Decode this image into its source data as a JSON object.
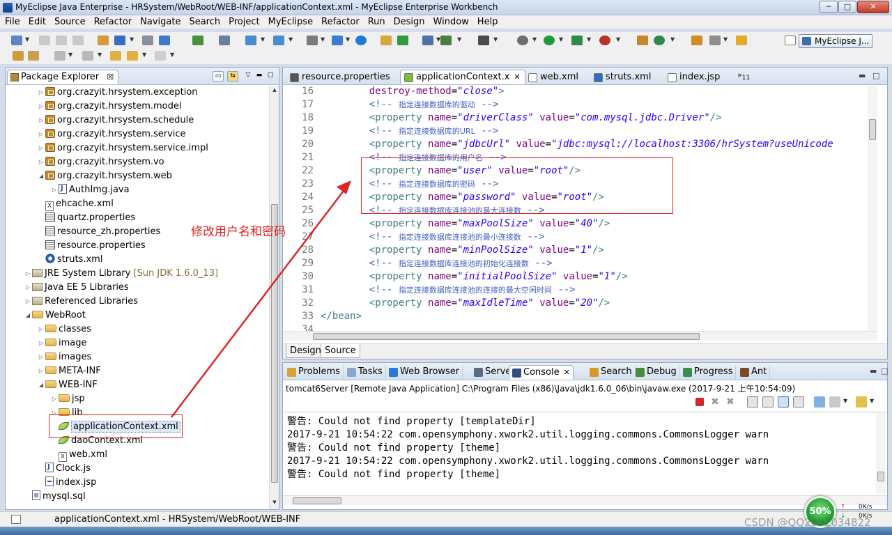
{
  "window": {
    "title": "MyEclipse Java Enterprise - HRSystem/WebRoot/WEB-INF/applicationContext.xml - MyEclipse Enterprise Workbench",
    "min": "─",
    "max": "□",
    "close": "✕"
  },
  "menu": [
    "File",
    "Edit",
    "Source",
    "Refactor",
    "Navigate",
    "Search",
    "Project",
    "MyEclipse",
    "Refactor",
    "Run",
    "Design",
    "Window",
    "Help"
  ],
  "perspective": "MyEclipse J...",
  "package_explorer": {
    "title": "Package Explorer",
    "close": "☒",
    "items": [
      {
        "label": "org.crazyit.hrsystem.exception",
        "icon": "package-icon",
        "depth": 2,
        "twisty": "▷"
      },
      {
        "label": "org.crazyit.hrsystem.model",
        "icon": "package-icon",
        "depth": 2,
        "twisty": "▷"
      },
      {
        "label": "org.crazyit.hrsystem.schedule",
        "icon": "package-icon",
        "depth": 2,
        "twisty": "▷"
      },
      {
        "label": "org.crazyit.hrsystem.service",
        "icon": "package-icon",
        "depth": 2,
        "twisty": "▷"
      },
      {
        "label": "org.crazyit.hrsystem.service.impl",
        "icon": "package-icon",
        "depth": 2,
        "twisty": "▷"
      },
      {
        "label": "org.crazyit.hrsystem.vo",
        "icon": "package-icon",
        "depth": 2,
        "twisty": "▷"
      },
      {
        "label": "org.crazyit.hrsystem.web",
        "icon": "package-icon",
        "depth": 2,
        "twisty": "◢"
      },
      {
        "label": "AuthImg.java",
        "icon": "java-file-icon",
        "depth": 3,
        "twisty": "▷"
      },
      {
        "label": "ehcache.xml",
        "icon": "xml-file-icon",
        "depth": 2,
        "twisty": ""
      },
      {
        "label": "quartz.properties",
        "icon": "properties-file-icon",
        "depth": 2,
        "twisty": ""
      },
      {
        "label": "resource_zh.properties",
        "icon": "properties-file-icon",
        "depth": 2,
        "twisty": ""
      },
      {
        "label": "resource.properties",
        "icon": "properties-file-icon",
        "depth": 2,
        "twisty": ""
      },
      {
        "label": "struts.xml",
        "icon": "struts-gear-icon",
        "depth": 2,
        "twisty": ""
      },
      {
        "label": "JRE System Library",
        "suffix": "[Sun JDK 1.6.0_13]",
        "icon": "library-icon",
        "depth": 1,
        "twisty": "▷"
      },
      {
        "label": "Java EE 5 Libraries",
        "icon": "library-icon",
        "depth": 1,
        "twisty": "▷"
      },
      {
        "label": "Referenced Libraries",
        "icon": "library-icon",
        "depth": 1,
        "twisty": "▷"
      },
      {
        "label": "WebRoot",
        "icon": "folder-icon",
        "depth": 1,
        "twisty": "◢"
      },
      {
        "label": "classes",
        "icon": "folder-icon",
        "depth": 2,
        "twisty": "▷"
      },
      {
        "label": "image",
        "icon": "folder-icon",
        "depth": 2,
        "twisty": "▷"
      },
      {
        "label": "images",
        "icon": "folder-icon",
        "depth": 2,
        "twisty": "▷"
      },
      {
        "label": "META-INF",
        "icon": "folder-icon",
        "depth": 2,
        "twisty": "▷"
      },
      {
        "label": "WEB-INF",
        "icon": "folder-icon",
        "depth": 2,
        "twisty": "◢"
      },
      {
        "label": "jsp",
        "icon": "folder-icon",
        "depth": 3,
        "twisty": "▷"
      },
      {
        "label": "lib",
        "icon": "folder-icon",
        "depth": 3,
        "twisty": "▷"
      },
      {
        "label": "applicationContext.xml",
        "icon": "spring-leaf-icon",
        "depth": 3,
        "twisty": "",
        "selected": true
      },
      {
        "label": "daoContext.xml",
        "icon": "spring-leaf-icon",
        "depth": 3,
        "twisty": ""
      },
      {
        "label": "web.xml",
        "icon": "xml-file-icon",
        "depth": 3,
        "twisty": ""
      },
      {
        "label": "Clock.js",
        "icon": "js-file-icon",
        "depth": 2,
        "twisty": ""
      },
      {
        "label": "index.jsp",
        "icon": "jsp-file-icon",
        "depth": 2,
        "twisty": ""
      },
      {
        "label": "mysql.sql",
        "icon": "sql-file-icon",
        "depth": 1,
        "twisty": ""
      }
    ]
  },
  "editor": {
    "tabs": [
      {
        "label": "resource.properties",
        "icon": "properties-file-icon",
        "active": false
      },
      {
        "label": "applicationContext.x",
        "icon": "spring-leaf-icon",
        "active": true,
        "closable": true
      },
      {
        "label": "web.xml",
        "icon": "xml-file-icon",
        "active": false
      },
      {
        "label": "struts.xml",
        "icon": "struts-gear-icon",
        "active": false
      },
      {
        "label": "index.jsp",
        "icon": "jsp-file-icon",
        "active": false
      }
    ],
    "overflow_label": "»",
    "overflow_count": "11",
    "close_glyph": "✕",
    "lines": [
      {
        "n": "16",
        "parts": [
          [
            "plain",
            "    "
          ],
          [
            "attr",
            "destroy-method"
          ],
          [
            "plain",
            "="
          ],
          [
            "val",
            "\"close\""
          ],
          [
            "tag",
            ">"
          ]
        ]
      },
      {
        "n": "17",
        "parts": [
          [
            "plain",
            "    "
          ],
          [
            "cmt",
            "<!-- "
          ],
          [
            "cmtcn",
            "指定连接数据库的驱动"
          ],
          [
            "cmt",
            " -->"
          ]
        ]
      },
      {
        "n": "18",
        "parts": [
          [
            "plain",
            "    "
          ],
          [
            "tag",
            "<property "
          ],
          [
            "attr",
            "name"
          ],
          [
            "plain",
            "="
          ],
          [
            "val",
            "\"driverClass\""
          ],
          [
            "plain",
            " "
          ],
          [
            "attr",
            "value"
          ],
          [
            "plain",
            "="
          ],
          [
            "val",
            "\"com.mysql.jdbc.Driver\""
          ],
          [
            "tag",
            "/>"
          ]
        ]
      },
      {
        "n": "19",
        "parts": [
          [
            "plain",
            "    "
          ],
          [
            "cmt",
            "<!-- "
          ],
          [
            "cmtcn",
            "指定连接数据库的URL"
          ],
          [
            "cmt",
            " -->"
          ]
        ]
      },
      {
        "n": "20",
        "parts": [
          [
            "plain",
            "    "
          ],
          [
            "tag",
            "<property "
          ],
          [
            "attr",
            "name"
          ],
          [
            "plain",
            "="
          ],
          [
            "val",
            "\"jdbcUrl\""
          ],
          [
            "plain",
            " "
          ],
          [
            "attr",
            "value"
          ],
          [
            "plain",
            "="
          ],
          [
            "val",
            "\"jdbc:mysql://localhost:3306/hrSystem?useUnicode"
          ]
        ]
      },
      {
        "n": "21",
        "parts": [
          [
            "plain",
            "    "
          ],
          [
            "cmt",
            "<!-- "
          ],
          [
            "cmtcn",
            "指定连接数据库的用户名"
          ],
          [
            "cmt",
            " -->"
          ]
        ]
      },
      {
        "n": "22",
        "parts": [
          [
            "plain",
            "    "
          ],
          [
            "tag",
            "<property "
          ],
          [
            "attr",
            "name"
          ],
          [
            "plain",
            "="
          ],
          [
            "val",
            "\"user\""
          ],
          [
            "plain",
            " "
          ],
          [
            "attr",
            "value"
          ],
          [
            "plain",
            "="
          ],
          [
            "val",
            "\"root\""
          ],
          [
            "tag",
            "/>"
          ]
        ]
      },
      {
        "n": "23",
        "parts": [
          [
            "plain",
            "    "
          ],
          [
            "cmt",
            "<!-- "
          ],
          [
            "cmtcn",
            "指定连接数据库的密码"
          ],
          [
            "cmt",
            " -->"
          ]
        ]
      },
      {
        "n": "24",
        "parts": [
          [
            "plain",
            "    "
          ],
          [
            "tag",
            "<property "
          ],
          [
            "attr",
            "name"
          ],
          [
            "plain",
            "="
          ],
          [
            "val",
            "\"password\""
          ],
          [
            "plain",
            " "
          ],
          [
            "attr",
            "value"
          ],
          [
            "plain",
            "="
          ],
          [
            "val",
            "\"root\""
          ],
          [
            "tag",
            "/>"
          ]
        ]
      },
      {
        "n": "25",
        "parts": [
          [
            "plain",
            "    "
          ],
          [
            "cmt",
            "<!-- "
          ],
          [
            "cmtcn",
            "指定连接数据库连接池的最大连接数"
          ],
          [
            "cmt",
            " -->"
          ]
        ]
      },
      {
        "n": "26",
        "parts": [
          [
            "plain",
            "    "
          ],
          [
            "tag",
            "<property "
          ],
          [
            "attr",
            "name"
          ],
          [
            "plain",
            "="
          ],
          [
            "val",
            "\"maxPoolSize\""
          ],
          [
            "plain",
            " "
          ],
          [
            "attr",
            "value"
          ],
          [
            "plain",
            "="
          ],
          [
            "val",
            "\"40\""
          ],
          [
            "tag",
            "/>"
          ]
        ]
      },
      {
        "n": "27",
        "parts": [
          [
            "plain",
            "    "
          ],
          [
            "cmt",
            "<!-- "
          ],
          [
            "cmtcn",
            "指定连接数据库连接池的最小连接数"
          ],
          [
            "cmt",
            " -->"
          ]
        ]
      },
      {
        "n": "28",
        "parts": [
          [
            "plain",
            "    "
          ],
          [
            "tag",
            "<property "
          ],
          [
            "attr",
            "name"
          ],
          [
            "plain",
            "="
          ],
          [
            "val",
            "\"minPoolSize\""
          ],
          [
            "plain",
            " "
          ],
          [
            "attr",
            "value"
          ],
          [
            "plain",
            "="
          ],
          [
            "val",
            "\"1\""
          ],
          [
            "tag",
            "/>"
          ]
        ]
      },
      {
        "n": "29",
        "parts": [
          [
            "plain",
            "    "
          ],
          [
            "cmt",
            "<!-- "
          ],
          [
            "cmtcn",
            "指定连接数据库连接池的初始化连接数"
          ],
          [
            "cmt",
            " -->"
          ]
        ]
      },
      {
        "n": "30",
        "parts": [
          [
            "plain",
            "    "
          ],
          [
            "tag",
            "<property "
          ],
          [
            "attr",
            "name"
          ],
          [
            "plain",
            "="
          ],
          [
            "val",
            "\"initialPoolSize\""
          ],
          [
            "plain",
            " "
          ],
          [
            "attr",
            "value"
          ],
          [
            "plain",
            "="
          ],
          [
            "val",
            "\"1\""
          ],
          [
            "tag",
            "/>"
          ]
        ]
      },
      {
        "n": "31",
        "parts": [
          [
            "plain",
            "    "
          ],
          [
            "cmt",
            "<!-- "
          ],
          [
            "cmtcn",
            "指定连接数据库连接池的连接的最大空闲时间"
          ],
          [
            "cmt",
            " -->"
          ]
        ]
      },
      {
        "n": "32",
        "parts": [
          [
            "plain",
            "    "
          ],
          [
            "tag",
            "<property "
          ],
          [
            "attr",
            "name"
          ],
          [
            "plain",
            "="
          ],
          [
            "val",
            "\"maxIdleTime\""
          ],
          [
            "plain",
            " "
          ],
          [
            "attr",
            "value"
          ],
          [
            "plain",
            "="
          ],
          [
            "val",
            "\"20\""
          ],
          [
            "tag",
            "/>"
          ]
        ]
      },
      {
        "n": "33",
        "parts": [
          [
            "tag",
            "</bean>"
          ]
        ]
      },
      {
        "n": "34",
        "parts": [
          [
            "plain",
            ""
          ]
        ]
      }
    ],
    "bottom_tabs": [
      {
        "label": "Design",
        "active": false
      },
      {
        "label": "Source",
        "active": true
      }
    ]
  },
  "annotation": {
    "text": "修改用户名和密码",
    "color": "#e02424"
  },
  "console": {
    "tabs": [
      {
        "label": "Problems",
        "icon": "problems-icon"
      },
      {
        "label": "Tasks",
        "icon": "tasks-icon"
      },
      {
        "label": "Web Browser",
        "icon": "globe-icon"
      },
      {
        "label": "Servers",
        "icon": "servers-icon"
      },
      {
        "label": "Console",
        "icon": "console-icon",
        "active": true,
        "closable": true
      },
      {
        "label": "Search",
        "icon": "search-icon"
      },
      {
        "label": "Debug",
        "icon": "debug-icon"
      },
      {
        "label": "Progress",
        "icon": "progress-icon"
      },
      {
        "label": "Ant",
        "icon": "ant-icon"
      }
    ],
    "process": "tomcat6Server [Remote Java Application] C:\\Program Files (x86)\\Java\\jdk1.6.0_06\\bin\\javaw.exe (2017-9-21 上午10:54:09)",
    "lines": [
      "警告: Could not find property [templateDir]",
      "2017-9-21 10:54:22 com.opensymphony.xwork2.util.logging.commons.CommonsLogger warn",
      "警告: Could not find property [theme]",
      "2017-9-21 10:54:22 com.opensymphony.xwork2.util.logging.commons.CommonsLogger warn",
      "警告: Could not find property [theme]"
    ]
  },
  "status": {
    "path": "applicationContext.xml - HRSystem/WebRoot/WEB-INF"
  },
  "network": {
    "percent": "50%",
    "up": "0K/s",
    "down": "0K/s"
  },
  "watermark": "CSDN @QQ2892034822",
  "colors": {
    "annotation_red": "#e02424",
    "xml_tag": "#3f7f7f",
    "xml_attr": "#7f007f",
    "xml_value": "#2a00ff",
    "xml_comment": "#3f5fbf"
  }
}
